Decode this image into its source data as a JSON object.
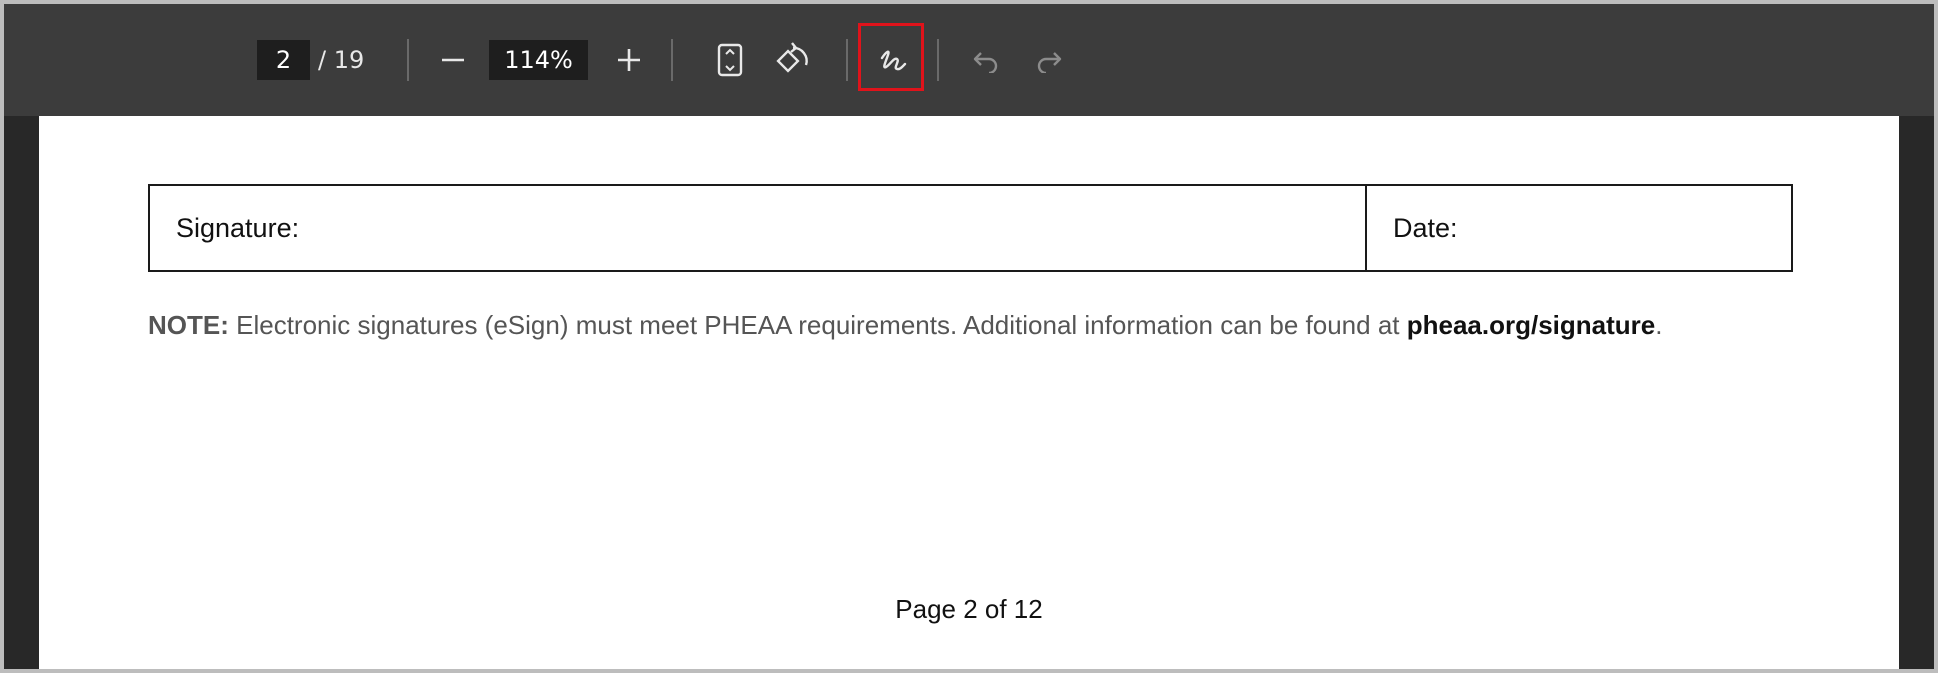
{
  "toolbar": {
    "current_page": "2",
    "page_total": "/ 19",
    "zoom": "114%",
    "buttons": {
      "zoom_out": "minus-icon",
      "zoom_in": "plus-icon",
      "fit_page": "fit-page-icon",
      "rotate": "rotate-icon",
      "draw": "signature-draw-icon",
      "undo": "undo-icon",
      "redo": "redo-icon"
    },
    "highlight_color": "#e0131b"
  },
  "document": {
    "signature_label": "Signature:",
    "date_label": "Date:",
    "note_label": "NOTE:",
    "note_text": " Electronic signatures (eSign) must meet PHEAA requirements. Additional information can be found at ",
    "note_link": "pheaa.org/signature",
    "note_end": ".",
    "footer": "Page 2 of 12"
  }
}
